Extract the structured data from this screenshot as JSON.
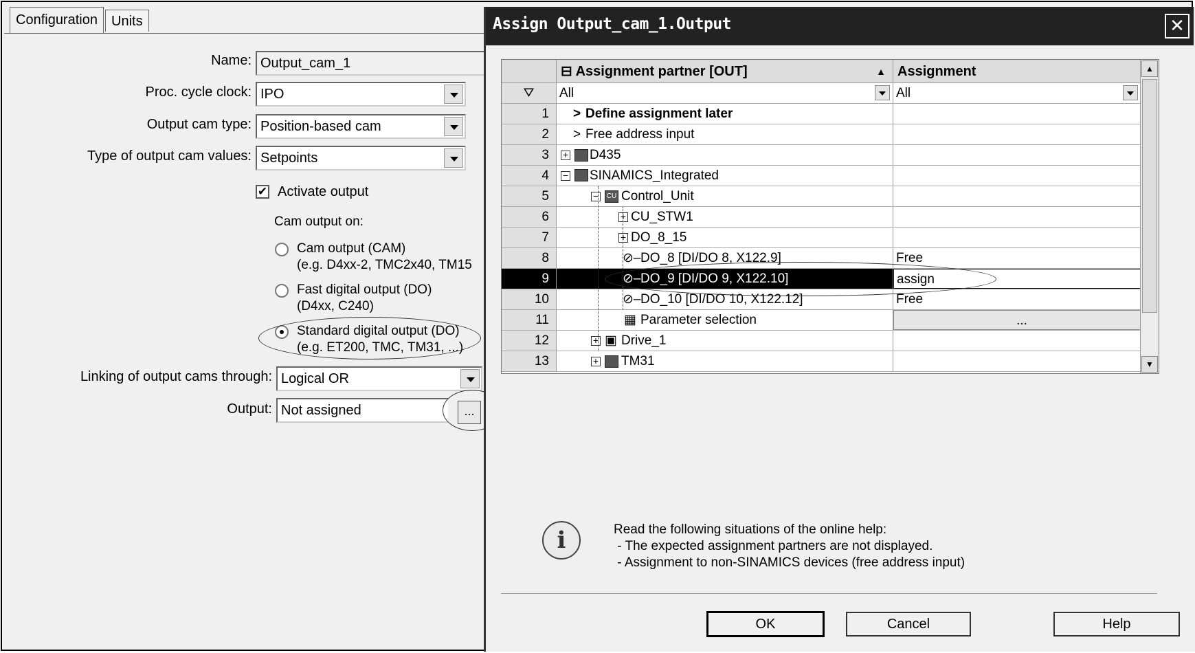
{
  "tabs": [
    "Configuration",
    "Units"
  ],
  "config": {
    "name_label": "Name:",
    "name_value": "Output_cam_1",
    "cycle_label": "Proc. cycle clock:",
    "cycle_value": "IPO",
    "type_label": "Output cam type:",
    "type_value": "Position-based cam",
    "values_label": "Type of output cam values:",
    "values_value": "Setpoints",
    "activate_label": "Activate output",
    "activate_checked": true,
    "cam_output_on": "Cam output on:",
    "radios": [
      {
        "line1": "Cam output (CAM)",
        "line2": "(e.g. D4xx-2, TMC2x40,  TM15",
        "selected": false
      },
      {
        "line1": "Fast digital output (DO)",
        "line2": "(D4xx, C240)",
        "selected": false
      },
      {
        "line1": "Standard digital output (DO)",
        "line2": "(e.g. ET200, TMC, TM31, ...)",
        "selected": true
      }
    ],
    "linking_label": "Linking of output cams through:",
    "linking_value": "Logical OR",
    "output_label": "Output:",
    "output_value": "Not assigned",
    "output_button": "..."
  },
  "dialog": {
    "title": "Assign Output_cam_1.Output",
    "close": "✕",
    "col_partner": "Assignment partner [OUT]",
    "col_assignment": "Assignment",
    "filter_partner": "All",
    "filter_assignment": "All",
    "rows": [
      {
        "n": "1",
        "label": "Define assignment later",
        "assign": ""
      },
      {
        "n": "2",
        "label": "Free address input",
        "assign": ""
      },
      {
        "n": "3",
        "label": "D435",
        "assign": ""
      },
      {
        "n": "4",
        "label": "SINAMICS_Integrated",
        "assign": ""
      },
      {
        "n": "5",
        "label": "Control_Unit",
        "assign": ""
      },
      {
        "n": "6",
        "label": "CU_STW1",
        "assign": ""
      },
      {
        "n": "7",
        "label": "DO_8_15",
        "assign": ""
      },
      {
        "n": "8",
        "label": "DO_8 [DI/DO 8, X122.9]",
        "assign": "Free"
      },
      {
        "n": "9",
        "label": "DO_9 [DI/DO 9, X122.10]",
        "assign": "assign"
      },
      {
        "n": "10",
        "label": "DO_10 [DI/DO 10, X122.12]",
        "assign": "Free"
      },
      {
        "n": "11",
        "label": "Parameter selection",
        "assign": "..."
      },
      {
        "n": "12",
        "label": "Drive_1",
        "assign": ""
      },
      {
        "n": "13",
        "label": "TM31",
        "assign": ""
      }
    ],
    "info_lines": [
      "Read the following situations of the online help:",
      " - The expected assignment partners are not displayed.",
      " - Assignment to non-SINAMICS devices (free address input)"
    ],
    "buttons": {
      "ok": "OK",
      "cancel": "Cancel",
      "help": "Help"
    }
  }
}
